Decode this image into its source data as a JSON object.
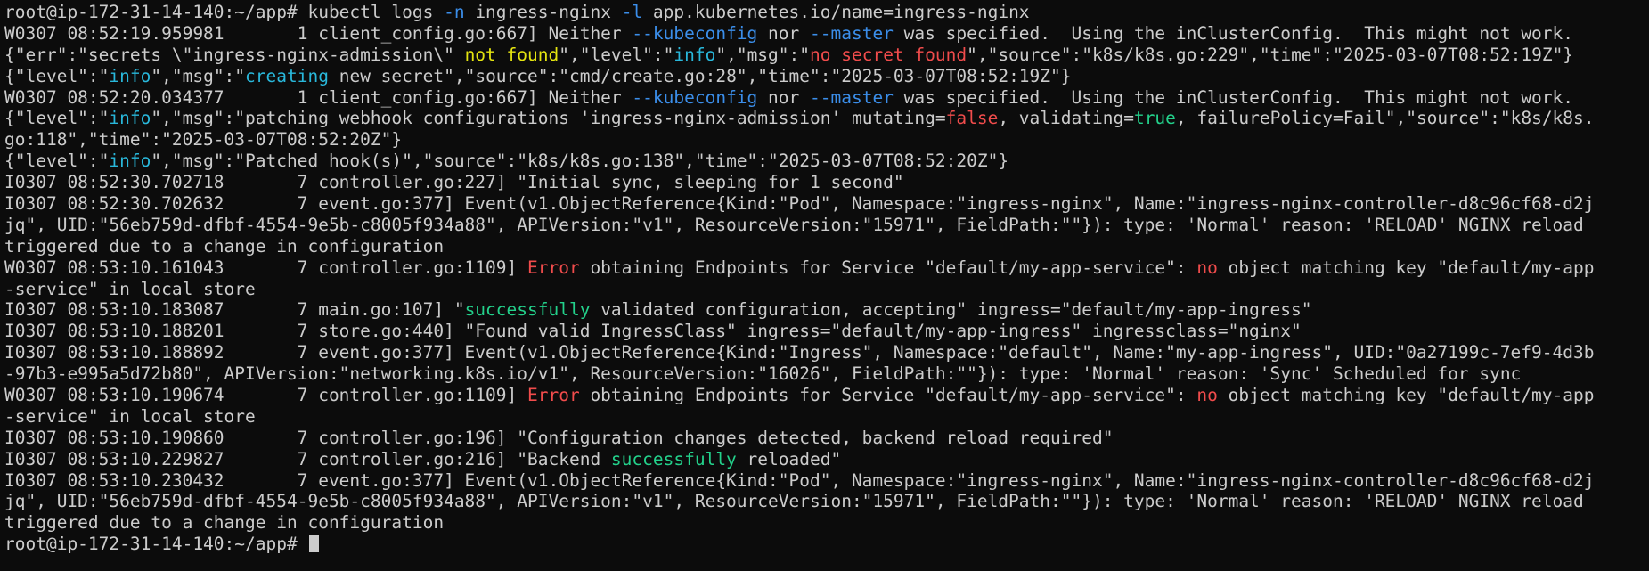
{
  "terminal": {
    "colors": {
      "background": "#0c0c0c",
      "default": "#cccccc",
      "blue": "#3b8eea",
      "cyan": "#29b8db",
      "yellow": "#e5e510",
      "red": "#f14c4c",
      "green": "#23d18b"
    },
    "lines": [
      [
        [
          "default",
          "root@ip-172-31-14-140:~/app# kubectl logs "
        ],
        [
          "blue",
          "-n"
        ],
        [
          "default",
          " ingress-nginx "
        ],
        [
          "blue",
          "-l"
        ],
        [
          "default",
          " app.kubernetes.io/name=ingress-nginx"
        ]
      ],
      [
        [
          "default",
          "W0307 08:52:19.959981       1 client_config.go:667] Neither "
        ],
        [
          "blue",
          "--kubeconfig"
        ],
        [
          "default",
          " nor "
        ],
        [
          "blue",
          "--master"
        ],
        [
          "default",
          " was specified.  Using the inClusterConfig.  This might not work."
        ]
      ],
      [
        [
          "default",
          "{\"err\":\"secrets \\\"ingress-nginx-admission\\\" "
        ],
        [
          "yellow",
          "not found"
        ],
        [
          "default",
          "\",\"level\":\""
        ],
        [
          "cyan",
          "info"
        ],
        [
          "default",
          "\",\"msg\":\""
        ],
        [
          "red",
          "no secret found"
        ],
        [
          "default",
          "\",\"source\":\"k8s/k8s.go:229\",\"time\":\"2025-03-07T08:52:19Z\"}"
        ]
      ],
      [
        [
          "default",
          "{\"level\":\""
        ],
        [
          "cyan",
          "info"
        ],
        [
          "default",
          "\",\"msg\":\""
        ],
        [
          "cyan",
          "creating"
        ],
        [
          "default",
          " new secret\",\"source\":\"cmd/create.go:28\",\"time\":\"2025-03-07T08:52:19Z\"}"
        ]
      ],
      [
        [
          "default",
          "W0307 08:52:20.034377       1 client_config.go:667] Neither "
        ],
        [
          "blue",
          "--kubeconfig"
        ],
        [
          "default",
          " nor "
        ],
        [
          "blue",
          "--master"
        ],
        [
          "default",
          " was specified.  Using the inClusterConfig.  This might not work."
        ]
      ],
      [
        [
          "default",
          "{\"level\":\""
        ],
        [
          "cyan",
          "info"
        ],
        [
          "default",
          "\",\"msg\":\"patching webhook configurations 'ingress-nginx-admission' mutating="
        ],
        [
          "red",
          "false"
        ],
        [
          "default",
          ", validating="
        ],
        [
          "green",
          "true"
        ],
        [
          "default",
          ", failurePolicy=Fail\",\"source\":\"k8s/k8s."
        ]
      ],
      [
        [
          "default",
          "go:118\",\"time\":\"2025-03-07T08:52:20Z\"}"
        ]
      ],
      [
        [
          "default",
          "{\"level\":\""
        ],
        [
          "cyan",
          "info"
        ],
        [
          "default",
          "\",\"msg\":\"Patched hook(s)\",\"source\":\"k8s/k8s.go:138\",\"time\":\"2025-03-07T08:52:20Z\"}"
        ]
      ],
      [
        [
          "default",
          "I0307 08:52:30.702718       7 controller.go:227] \"Initial sync, sleeping for 1 second\""
        ]
      ],
      [
        [
          "default",
          "I0307 08:52:30.702632       7 event.go:377] Event(v1.ObjectReference{Kind:\"Pod\", Namespace:\"ingress-nginx\", Name:\"ingress-nginx-controller-d8c96cf68-d2j"
        ]
      ],
      [
        [
          "default",
          "jq\", UID:\"56eb759d-dfbf-4554-9e5b-c8005f934a88\", APIVersion:\"v1\", ResourceVersion:\"15971\", FieldPath:\"\"}): type: 'Normal' reason: 'RELOAD' NGINX reload"
        ]
      ],
      [
        [
          "default",
          "triggered due to a change in configuration"
        ]
      ],
      [
        [
          "default",
          "W0307 08:53:10.161043       7 controller.go:1109] "
        ],
        [
          "red",
          "Error"
        ],
        [
          "default",
          " obtaining Endpoints for Service \"default/my-app-service\": "
        ],
        [
          "red",
          "no"
        ],
        [
          "default",
          " object matching key \"default/my-app"
        ]
      ],
      [
        [
          "default",
          "-service\" in local store"
        ]
      ],
      [
        [
          "default",
          "I0307 08:53:10.183087       7 main.go:107] \""
        ],
        [
          "green",
          "successfully"
        ],
        [
          "default",
          " validated configuration, accepting\" ingress=\"default/my-app-ingress\""
        ]
      ],
      [
        [
          "default",
          "I0307 08:53:10.188201       7 store.go:440] \"Found valid IngressClass\" ingress=\"default/my-app-ingress\" ingressclass=\"nginx\""
        ]
      ],
      [
        [
          "default",
          "I0307 08:53:10.188892       7 event.go:377] Event(v1.ObjectReference{Kind:\"Ingress\", Namespace:\"default\", Name:\"my-app-ingress\", UID:\"0a27199c-7ef9-4d3b"
        ]
      ],
      [
        [
          "default",
          "-97b3-e995a5d72b80\", APIVersion:\"networking.k8s.io/v1\", ResourceVersion:\"16026\", FieldPath:\"\"}): type: 'Normal' reason: 'Sync' Scheduled for sync"
        ]
      ],
      [
        [
          "default",
          "W0307 08:53:10.190674       7 controller.go:1109] "
        ],
        [
          "red",
          "Error"
        ],
        [
          "default",
          " obtaining Endpoints for Service \"default/my-app-service\": "
        ],
        [
          "red",
          "no"
        ],
        [
          "default",
          " object matching key \"default/my-app"
        ]
      ],
      [
        [
          "default",
          "-service\" in local store"
        ]
      ],
      [
        [
          "default",
          "I0307 08:53:10.190860       7 controller.go:196] \"Configuration changes detected, backend reload required\""
        ]
      ],
      [
        [
          "default",
          "I0307 08:53:10.229827       7 controller.go:216] \"Backend "
        ],
        [
          "green",
          "successfully"
        ],
        [
          "default",
          " reloaded\""
        ]
      ],
      [
        [
          "default",
          "I0307 08:53:10.230432       7 event.go:377] Event(v1.ObjectReference{Kind:\"Pod\", Namespace:\"ingress-nginx\", Name:\"ingress-nginx-controller-d8c96cf68-d2j"
        ]
      ],
      [
        [
          "default",
          "jq\", UID:\"56eb759d-dfbf-4554-9e5b-c8005f934a88\", APIVersion:\"v1\", ResourceVersion:\"15971\", FieldPath:\"\"}): type: 'Normal' reason: 'RELOAD' NGINX reload"
        ]
      ],
      [
        [
          "default",
          "triggered due to a change in configuration"
        ]
      ]
    ],
    "prompt": "root@ip-172-31-14-140:~/app# "
  }
}
